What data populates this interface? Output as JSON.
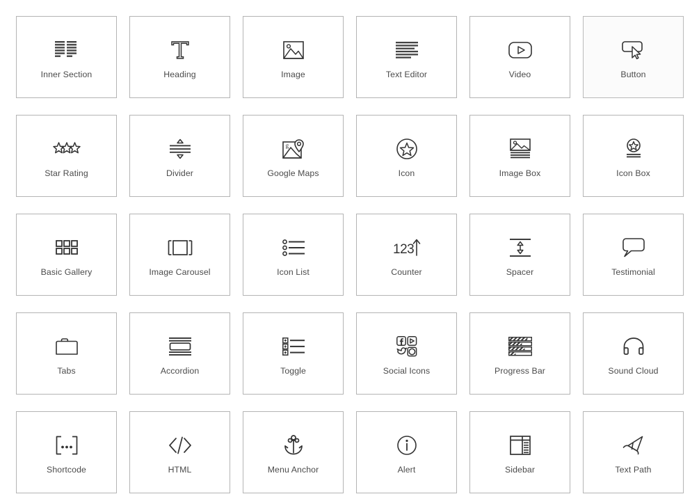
{
  "panel": {
    "name": "elements-widget-panel",
    "background": "#ffffff",
    "card_border_color": "#b4b4b4",
    "label_color": "#4b4b4b",
    "icon_color": "#3c3c3c",
    "hover_background": "#fbfbfb",
    "columns": 6,
    "rows": 5
  },
  "widgets": [
    {
      "label": "Inner Section",
      "icon": "inner-section-icon",
      "hover": false
    },
    {
      "label": "Heading",
      "icon": "heading-t-icon",
      "hover": false
    },
    {
      "label": "Image",
      "icon": "image-icon",
      "hover": false
    },
    {
      "label": "Text Editor",
      "icon": "text-editor-icon",
      "hover": false
    },
    {
      "label": "Video",
      "icon": "video-play-icon",
      "hover": false
    },
    {
      "label": "Button",
      "icon": "button-cursor-icon",
      "hover": true
    },
    {
      "label": "Star Rating",
      "icon": "star-rating-icon",
      "hover": false
    },
    {
      "label": "Divider",
      "icon": "divider-icon",
      "hover": false
    },
    {
      "label": "Google Maps",
      "icon": "google-maps-icon",
      "hover": false
    },
    {
      "label": "Icon",
      "icon": "star-circle-icon",
      "hover": false
    },
    {
      "label": "Image Box",
      "icon": "image-box-icon",
      "hover": false
    },
    {
      "label": "Icon Box",
      "icon": "icon-box-icon",
      "hover": false
    },
    {
      "label": "Basic Gallery",
      "icon": "basic-gallery-icon",
      "hover": false
    },
    {
      "label": "Image Carousel",
      "icon": "image-carousel-icon",
      "hover": false
    },
    {
      "label": "Icon List",
      "icon": "icon-list-icon",
      "hover": false
    },
    {
      "label": "Counter",
      "icon": "counter-icon",
      "hover": false
    },
    {
      "label": "Spacer",
      "icon": "spacer-icon",
      "hover": false
    },
    {
      "label": "Testimonial",
      "icon": "testimonial-icon",
      "hover": false
    },
    {
      "label": "Tabs",
      "icon": "tabs-icon",
      "hover": false
    },
    {
      "label": "Accordion",
      "icon": "accordion-icon",
      "hover": false
    },
    {
      "label": "Toggle",
      "icon": "toggle-icon",
      "hover": false
    },
    {
      "label": "Social Icons",
      "icon": "social-icons-icon",
      "hover": false
    },
    {
      "label": "Progress Bar",
      "icon": "progress-bar-icon",
      "hover": false
    },
    {
      "label": "Sound Cloud",
      "icon": "sound-cloud-icon",
      "hover": false
    },
    {
      "label": "Shortcode",
      "icon": "shortcode-icon",
      "hover": false
    },
    {
      "label": "HTML",
      "icon": "html-code-icon",
      "hover": false
    },
    {
      "label": "Menu Anchor",
      "icon": "menu-anchor-icon",
      "hover": false
    },
    {
      "label": "Alert",
      "icon": "alert-info-icon",
      "hover": false
    },
    {
      "label": "Sidebar",
      "icon": "sidebar-icon",
      "hover": false
    },
    {
      "label": "Text Path",
      "icon": "text-path-icon",
      "hover": false
    }
  ],
  "counter_text": "123"
}
